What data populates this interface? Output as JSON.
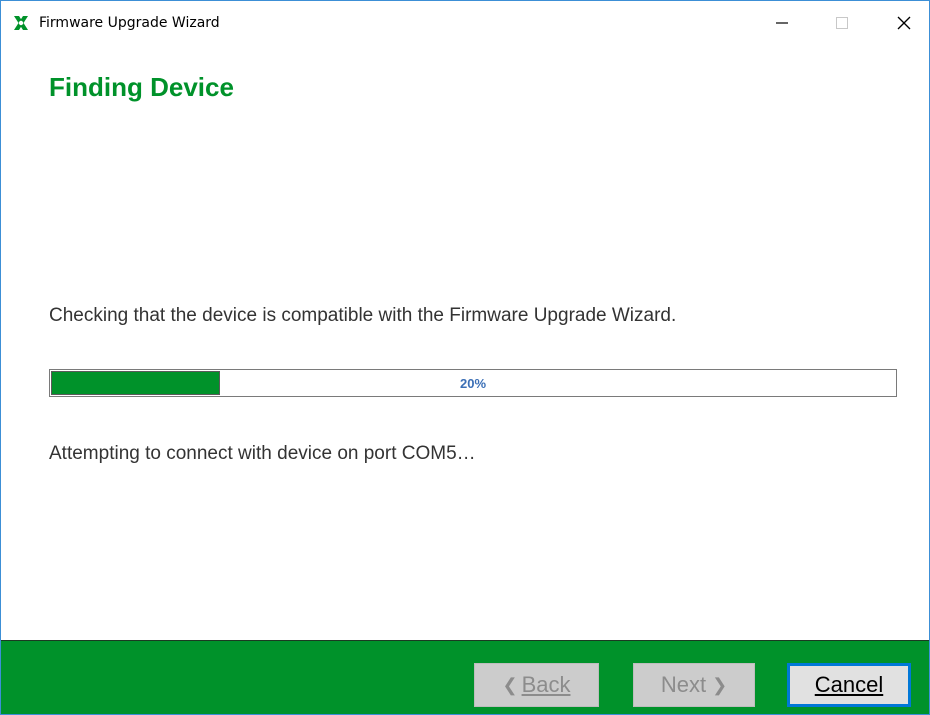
{
  "window": {
    "title": "Firmware Upgrade Wizard",
    "icons": {
      "app": "green-x-app-icon",
      "minimize": "minimize-icon",
      "maximize": "maximize-icon",
      "close": "close-icon"
    }
  },
  "page": {
    "heading": "Finding Device",
    "message": "Checking that the device is compatible with the Firmware Upgrade Wizard.",
    "progress": {
      "percent": 20,
      "label": "20%"
    },
    "status": "Attempting to connect with device on port COM5…"
  },
  "footer": {
    "back": {
      "label": "Back",
      "enabled": false
    },
    "next": {
      "label": "Next",
      "enabled": false
    },
    "cancel": {
      "label": "Cancel",
      "enabled": true
    }
  },
  "colors": {
    "accent": "#00922a",
    "progress_text": "#3b6fb6",
    "focus_border": "#0078d7"
  }
}
